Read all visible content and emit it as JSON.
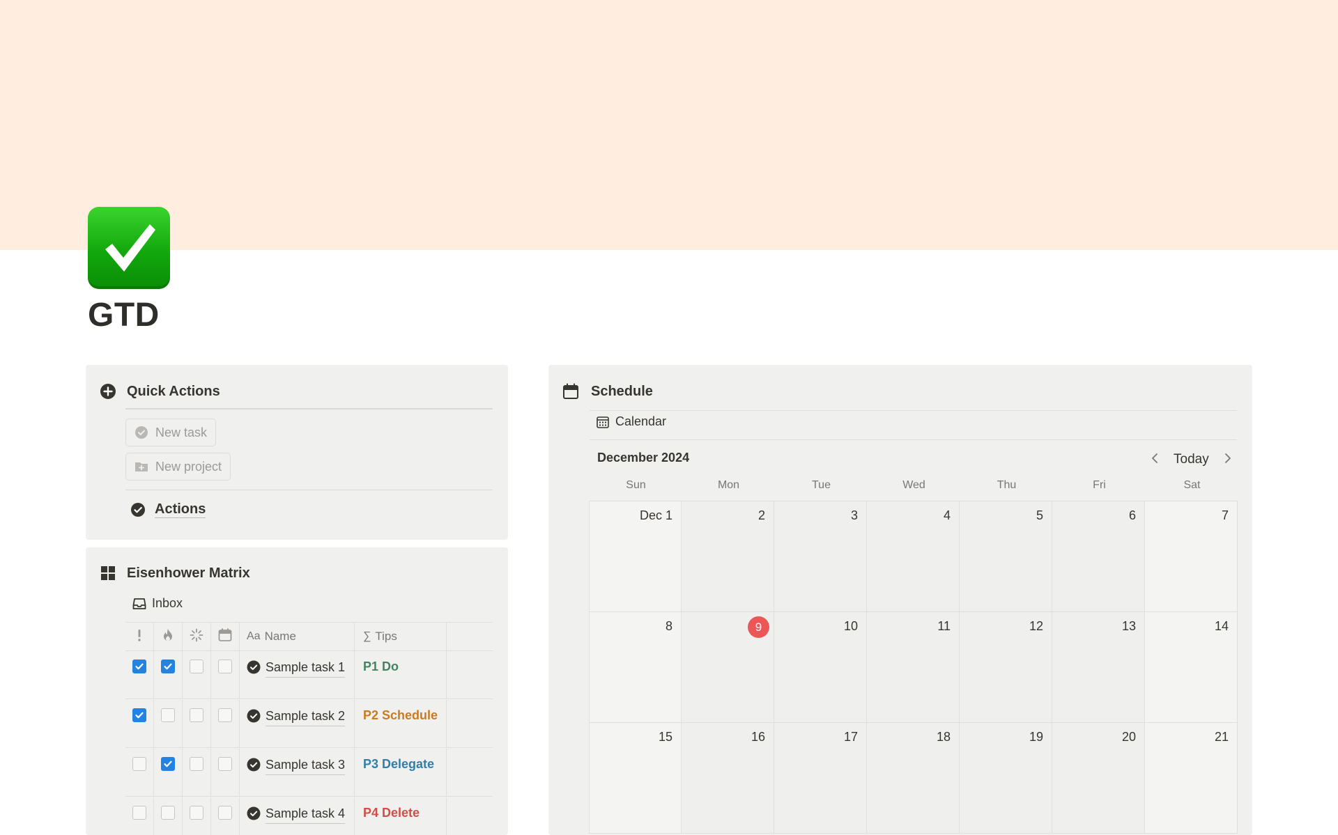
{
  "page": {
    "title": "GTD",
    "icon": "check-mark-button-icon"
  },
  "quick_actions": {
    "heading": "Quick Actions",
    "heading_icon": "plus-circle-icon",
    "buttons": [
      {
        "label": "New task",
        "icon": "check-circle-icon"
      },
      {
        "label": "New project",
        "icon": "folder-plus-icon"
      }
    ],
    "link": {
      "label": "Actions",
      "icon": "check-circle-icon"
    }
  },
  "eisenhower": {
    "heading": "Eisenhower Matrix",
    "heading_icon": "grid-icon",
    "view": {
      "label": "Inbox",
      "icon": "inbox-icon"
    },
    "columns": [
      {
        "key": "important",
        "icon": "exclamation-icon"
      },
      {
        "key": "urgent",
        "icon": "fire-icon"
      },
      {
        "key": "in_progress",
        "icon": "loading-icon"
      },
      {
        "key": "date",
        "icon": "calendar-icon"
      },
      {
        "key": "name",
        "label": "Name",
        "icon_text": "Aa"
      },
      {
        "key": "tips",
        "label": "Tips",
        "icon_text": "∑"
      }
    ],
    "rows": [
      {
        "important": true,
        "urgent": true,
        "in_progress": false,
        "date": false,
        "name": "Sample task 1",
        "tip": "P1 Do",
        "tip_color": "#448361"
      },
      {
        "important": true,
        "urgent": false,
        "in_progress": false,
        "date": false,
        "name": "Sample task 2",
        "tip": "P2 Schedule",
        "tip_color": "#cb7b1f"
      },
      {
        "important": false,
        "urgent": true,
        "in_progress": false,
        "date": false,
        "name": "Sample task 3",
        "tip": "P3 Delegate",
        "tip_color": "#337ea9"
      },
      {
        "important": false,
        "urgent": false,
        "in_progress": false,
        "date": false,
        "name": "Sample task 4",
        "tip": "P4 Delete",
        "tip_color": "#d44c47"
      }
    ]
  },
  "schedule": {
    "heading": "Schedule",
    "heading_icon": "calendar-icon",
    "view": {
      "label": "Calendar",
      "icon": "calendar-grid-icon"
    },
    "month": "December 2024",
    "today_label": "Today",
    "weekdays": [
      "Sun",
      "Mon",
      "Tue",
      "Wed",
      "Thu",
      "Fri",
      "Sat"
    ],
    "weeks": [
      [
        "Dec 1",
        "2",
        "3",
        "4",
        "5",
        "6",
        "7"
      ],
      [
        "8",
        "9",
        "10",
        "11",
        "12",
        "13",
        "14"
      ],
      [
        "15",
        "16",
        "17",
        "18",
        "19",
        "20",
        "21"
      ]
    ],
    "today_date": "9",
    "today_color": "#eb5757"
  }
}
